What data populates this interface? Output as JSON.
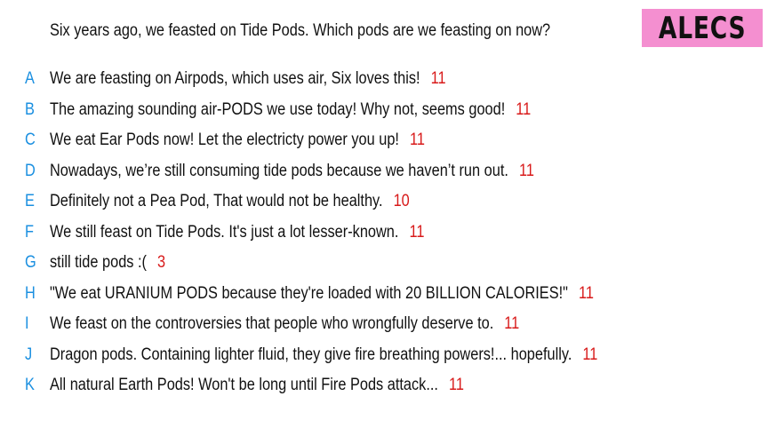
{
  "question": "Six years ago, we feasted on Tide Pods. Which pods are we feasting on now?",
  "badge": "ALECS",
  "colors": {
    "letter": "#1a8fe0",
    "score": "#d81a1a",
    "badge_background": "#f48fd0"
  },
  "answers": [
    {
      "letter": "A",
      "text": "We are feasting on Airpods, which uses air, Six loves this!",
      "score": "11"
    },
    {
      "letter": "B",
      "text": "The amazing sounding air-PODS we use today! Why not, seems good!",
      "score": "11"
    },
    {
      "letter": "C",
      "text": "We eat Ear Pods now! Let the electricty power you up!",
      "score": "11"
    },
    {
      "letter": "D",
      "text": "Nowadays, we’re still consuming tide pods because we haven’t run out.",
      "score": "11"
    },
    {
      "letter": "E",
      "text": "Definitely not a Pea Pod, That would not be healthy.",
      "score": "10"
    },
    {
      "letter": "F",
      "text": "We still feast on Tide Pods. It's just a lot lesser-known.",
      "score": "11"
    },
    {
      "letter": "G",
      "text": "still tide pods :(",
      "score": "3"
    },
    {
      "letter": "H",
      "text": "\"We eat URANIUM PODS because they're loaded with 20 BILLION CALORIES!\"",
      "score": "11"
    },
    {
      "letter": "I",
      "text": "We feast on the controversies that people who wrongfully deserve to.",
      "score": "11"
    },
    {
      "letter": "J",
      "text": "Dragon pods. Containing lighter fluid, they give fire breathing powers!... hopefully.",
      "score": "11"
    },
    {
      "letter": "K",
      "text": "All natural Earth Pods! Won't be long until Fire Pods attack...",
      "score": "11"
    }
  ]
}
